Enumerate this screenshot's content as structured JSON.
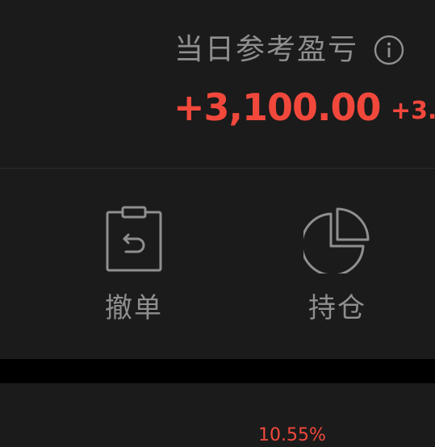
{
  "pnl": {
    "label": "当日参考盈亏",
    "value": "+3,100.00",
    "rate": "+3.",
    "info_icon": "info-circle-icon"
  },
  "actions": [
    {
      "label": "撤单",
      "icon": "clipboard-undo-icon"
    },
    {
      "label": "持仓",
      "icon": "pie-chart-icon"
    }
  ],
  "bottom": {
    "percentage": "10.55%"
  },
  "colors": {
    "background": "#1b1b1b",
    "separator": "#000000",
    "label_gray": "#8f8f8f",
    "profit_red": "#f2483c"
  }
}
